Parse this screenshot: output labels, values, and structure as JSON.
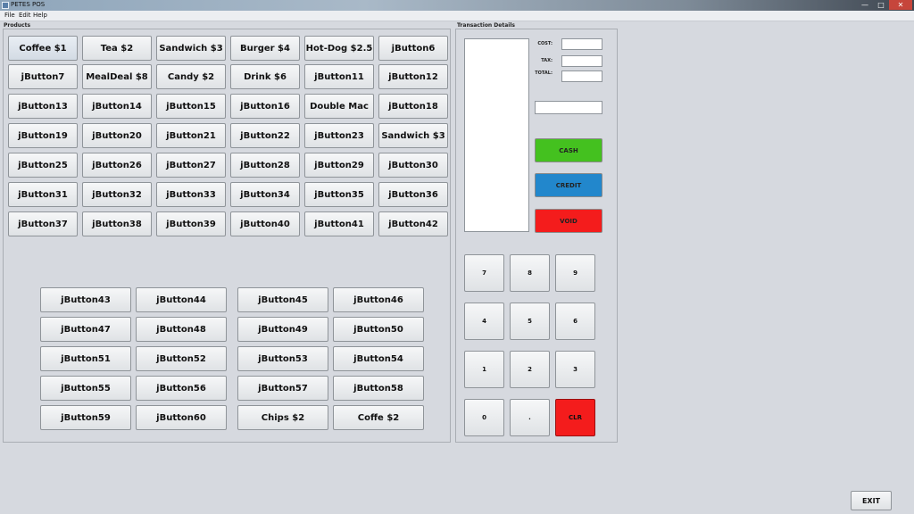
{
  "window": {
    "title": "PETES POS",
    "minimize": "—",
    "maximize": "□",
    "close": "✕"
  },
  "menu": [
    "File",
    "Edit",
    "Help"
  ],
  "products": {
    "label": "Products",
    "grid": [
      [
        "Coffee $1",
        "Tea $2",
        "Sandwich $3",
        "Burger $4",
        "Hot-Dog $2.5",
        "jButton6"
      ],
      [
        "jButton7",
        "MealDeal $8",
        "Candy $2",
        "Drink $6",
        "jButton11",
        "jButton12"
      ],
      [
        "jButton13",
        "jButton14",
        "jButton15",
        "jButton16",
        "Double Mac",
        "jButton18"
      ],
      [
        "jButton19",
        "jButton20",
        "jButton21",
        "jButton22",
        "jButton23",
        "Sandwich $3"
      ],
      [
        "jButton25",
        "jButton26",
        "jButton27",
        "jButton28",
        "jButton29",
        "jButton30"
      ],
      [
        "jButton31",
        "jButton32",
        "jButton33",
        "jButton34",
        "jButton35",
        "jButton36"
      ],
      [
        "jButton37",
        "jButton38",
        "jButton39",
        "jButton40",
        "jButton41",
        "jButton42"
      ]
    ],
    "lower_grid": [
      [
        "jButton43",
        "jButton44",
        "jButton45",
        "jButton46"
      ],
      [
        "jButton47",
        "jButton48",
        "jButton49",
        "jButton50"
      ],
      [
        "jButton51",
        "jButton52",
        "jButton53",
        "jButton54"
      ],
      [
        "jButton55",
        "jButton56",
        "jButton57",
        "jButton58"
      ],
      [
        "jButton59",
        "jButton60",
        "Chips $2",
        "Coffe $2"
      ]
    ]
  },
  "transaction": {
    "label": "Transaction Details",
    "cost_label": "COST:",
    "cost_value": "",
    "tax_label": "TAX:",
    "tax_value": "",
    "total_label": "TOTAL:",
    "total_value": "",
    "input_value": "",
    "cash": "CASH",
    "credit": "CREDIT",
    "void": "VOID",
    "keypad": [
      [
        "7",
        "8",
        "9"
      ],
      [
        "4",
        "5",
        "6"
      ],
      [
        "1",
        "2",
        "3"
      ],
      [
        "0",
        ".",
        "CLR"
      ]
    ]
  },
  "colors": {
    "cash": "#44c11f",
    "credit": "#2287cc",
    "void": "#f41c1c",
    "clr": "#f41c1c"
  },
  "exit": "EXIT"
}
